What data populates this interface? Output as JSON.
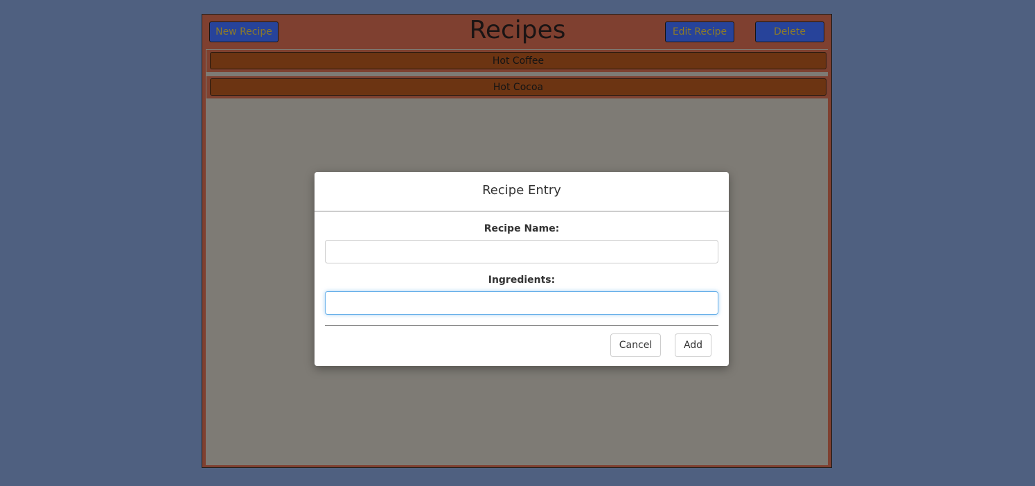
{
  "header": {
    "title": "Recipes",
    "new_label": "New Recipe",
    "edit_label": "Edit Recipe",
    "delete_label": "Delete"
  },
  "recipes": [
    {
      "name": "Hot Coffee"
    },
    {
      "name": "Hot Cocoa"
    }
  ],
  "modal": {
    "title": "Recipe Entry",
    "name_label": "Recipe Name:",
    "name_value": "",
    "ingredients_label": "Ingredients:",
    "ingredients_value": "",
    "cancel_label": "Cancel",
    "add_label": "Add"
  },
  "colors": {
    "page_background": "#4f6080",
    "app_background": "#7f4030",
    "button_blue": "#27439a",
    "button_text": "#8c7a2a",
    "recipe_item": "#6c3412",
    "overlay_gray": "#7e7b75",
    "focus_blue": "#66afe9"
  }
}
